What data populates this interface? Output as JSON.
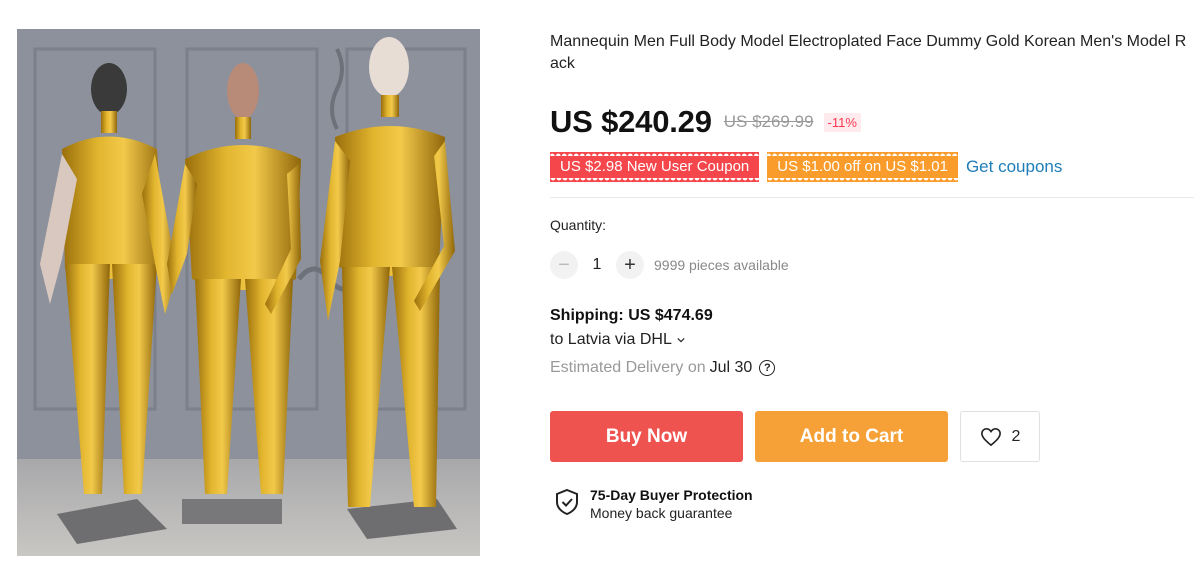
{
  "product": {
    "title": "Mannequin Men Full Body Model Electroplated Face Dummy Gold Korean Men's Model Rack",
    "image_icon": "product-photo-gold-mannequins"
  },
  "price": {
    "current": "US $240.29",
    "original": "US $269.99",
    "discount": "-11%"
  },
  "coupons": {
    "new_user": "US $2.98 New User Coupon",
    "store": "US $1.00 off on US $1.01",
    "get_label": "Get coupons"
  },
  "quantity": {
    "label": "Quantity:",
    "minus": "−",
    "value": "1",
    "plus": "+",
    "available": "9999 pieces available"
  },
  "shipping": {
    "cost": "Shipping: US $474.69",
    "route": "to Latvia via DHL",
    "delivery_label": "Estimated Delivery on",
    "delivery_date": "Jul 30",
    "help": "?"
  },
  "actions": {
    "buy_now": "Buy Now",
    "add_to_cart": "Add to Cart",
    "wishlist_count": "2"
  },
  "protection": {
    "title": "75-Day Buyer Protection",
    "subtitle": "Money back guarantee"
  },
  "colors": {
    "buy_now": "#ef5350",
    "add_to_cart": "#f6a138",
    "coupon_red": "#f5474b",
    "coupon_orange": "#f99c2c",
    "link": "#1f7db8",
    "discount": "#fd384f"
  }
}
